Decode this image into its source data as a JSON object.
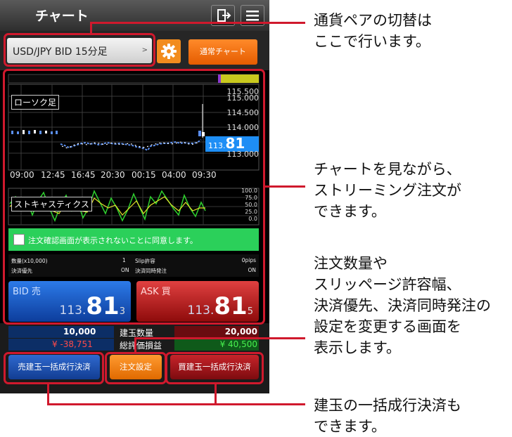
{
  "app": {
    "title": "チャート"
  },
  "toolbar": {
    "pair_label": "USD/JPY  BID  15分足",
    "pair_chevron": ">",
    "normal_chart_label": "通常チャート"
  },
  "chart": {
    "candle_label": "ローソク足",
    "stoch_label": "ストキャスティクス",
    "y_ticks": [
      "115.500",
      "115.000",
      "114.500",
      "114.000",
      "113.000"
    ],
    "x_ticks": [
      "09:00",
      "12:45",
      "16:45",
      "20:30",
      "00:15",
      "04:00",
      "09:30"
    ],
    "current_price_prefix": "113.",
    "current_price_big": "81",
    "stoch_ticks": [
      "100.0",
      "75.0",
      "50.0",
      "25.0",
      "0.0"
    ]
  },
  "consent": {
    "text": "注文確認画面が表示されないことに同意します。"
  },
  "order_info": {
    "qty_label": "数量(x10,000)",
    "qty_value": "1",
    "slip_label": "Slip許容",
    "slip_value": "0pips",
    "priority_label": "決済優先",
    "priority_value": "ON",
    "simul_label": "決済同時発注",
    "simul_value": "ON"
  },
  "bid": {
    "label": "BID 売",
    "price_prefix": "113.",
    "price_big": "81",
    "price_sub": "3"
  },
  "ask": {
    "label": "ASK 買",
    "price_prefix": "113.",
    "price_big": "81",
    "price_sub": "5"
  },
  "positions": {
    "sell_qty": "10,000",
    "qty_label": "建玉数量",
    "buy_qty": "20,000",
    "sell_pl": "¥ -38,751",
    "pl_label": "総評価損益",
    "buy_pl": "¥ 40,500"
  },
  "buttons": {
    "sell_close_all": "売建玉一括成行決済",
    "order_settings": "注文設定",
    "buy_close_all": "買建玉一括成行決済"
  },
  "annotations": {
    "pair_switch": [
      "通貨ペアの切替は",
      "ここで行います。"
    ],
    "streaming": [
      "チャートを見ながら、",
      "ストリーミング注文が",
      "できます。"
    ],
    "settings": [
      "注文数量や",
      "スリッページ許容幅、",
      "決済優先、決済同時発注の",
      "設定を変更する画面を",
      "表示します。"
    ],
    "close_all": [
      "建玉の一括成行決済も",
      "できます。"
    ]
  },
  "colors": {
    "highlight": "#d0192d",
    "bid": "#1f5fcf",
    "ask": "#c41b1b",
    "accent_orange": "#f28c1e",
    "consent_green": "#2bd05a"
  }
}
